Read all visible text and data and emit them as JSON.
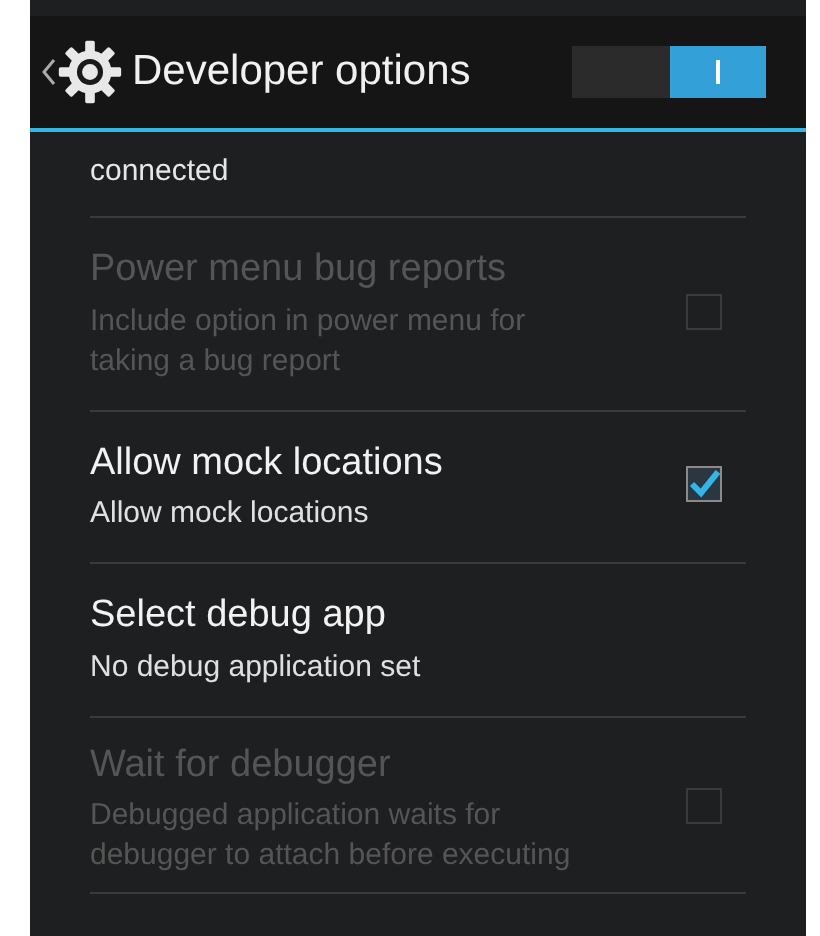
{
  "action_bar": {
    "title": "Developer options",
    "master_switch": {
      "on": true
    }
  },
  "settings": [
    {
      "kind": "partial",
      "summary": "connected"
    },
    {
      "kind": "checkbox",
      "title": "Power menu bug reports",
      "summary": "Include option in power menu for taking a bug report",
      "checked": false,
      "disabled": true
    },
    {
      "kind": "checkbox",
      "title": "Allow mock locations",
      "summary": "Allow mock locations",
      "checked": true,
      "disabled": false
    },
    {
      "kind": "plain",
      "title": "Select debug app",
      "summary": "No debug application set",
      "disabled": false
    },
    {
      "kind": "checkbox",
      "title": "Wait for debugger",
      "summary": "Debugged application waits for debugger to attach before executing",
      "checked": false,
      "disabled": true
    }
  ]
}
